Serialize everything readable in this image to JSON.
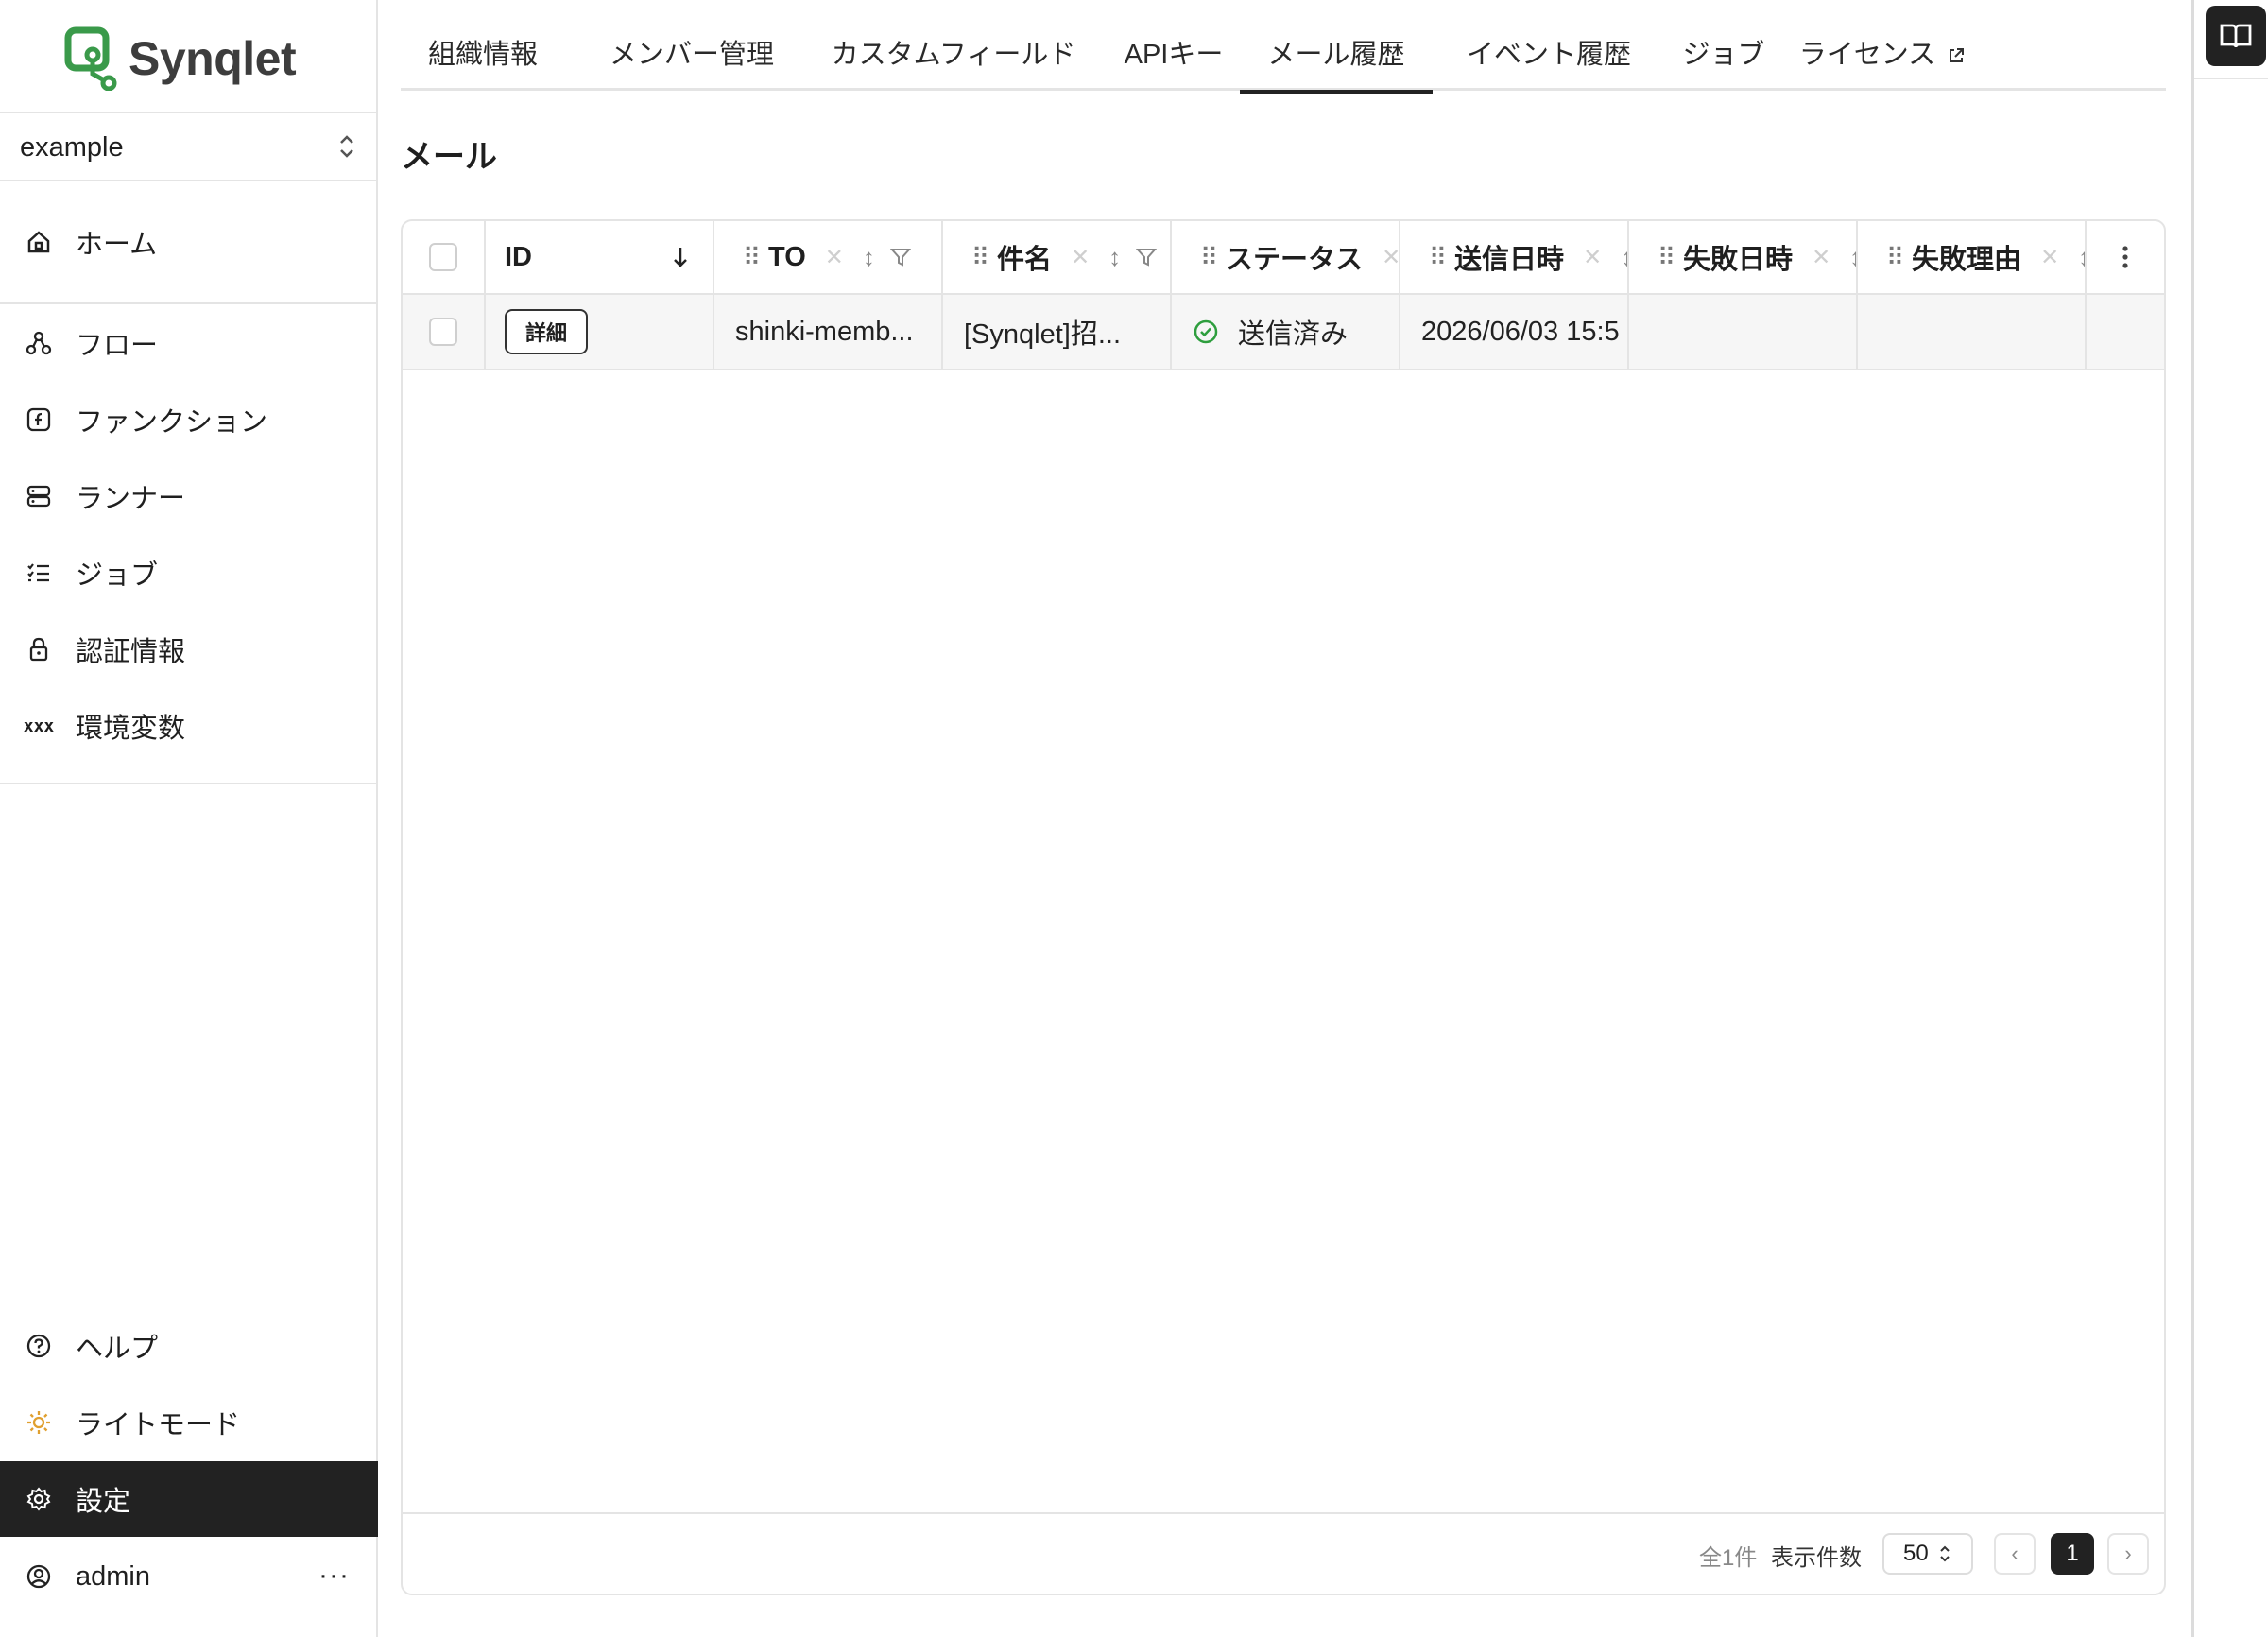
{
  "brand": {
    "name": "Synqlet",
    "accent": "#3a9a4a"
  },
  "workspace": {
    "selected": "example"
  },
  "sidebar": {
    "items": [
      {
        "label": "ホーム",
        "icon": "home-icon"
      },
      {
        "label": "フロー",
        "icon": "flow-icon"
      },
      {
        "label": "ファンクション",
        "icon": "function-icon"
      },
      {
        "label": "ランナー",
        "icon": "server-icon"
      },
      {
        "label": "ジョブ",
        "icon": "list-check-icon"
      },
      {
        "label": "認証情報",
        "icon": "lock-icon"
      },
      {
        "label": "環境変数",
        "icon": "variable-icon"
      }
    ],
    "bottom": {
      "help": "ヘルプ",
      "theme": "ライトモード",
      "settings": "設定",
      "user": "admin",
      "more": "···"
    }
  },
  "tabs": [
    "組織情報",
    "メンバー管理",
    "カスタムフィールド",
    "APIキー",
    "メール履歴",
    "イベント履歴",
    "ジョブ",
    "ライセンス"
  ],
  "active_tab": "メール履歴",
  "page": {
    "title": "メール"
  },
  "table": {
    "columns": [
      "ID",
      "TO",
      "件名",
      "ステータス",
      "送信日時",
      "失敗日時",
      "失敗理由"
    ],
    "rows": [
      {
        "id_button": "詳細",
        "to": "shinki-memb...",
        "subject": "[Synqlet]招...",
        "status": "送信済み",
        "sent_at": "2026/06/03 15:5",
        "failed_at": "",
        "reason": ""
      }
    ]
  },
  "pagination": {
    "total": "全1件",
    "per_page_label": "表示件数",
    "per_page": "50",
    "current_page": "1"
  }
}
